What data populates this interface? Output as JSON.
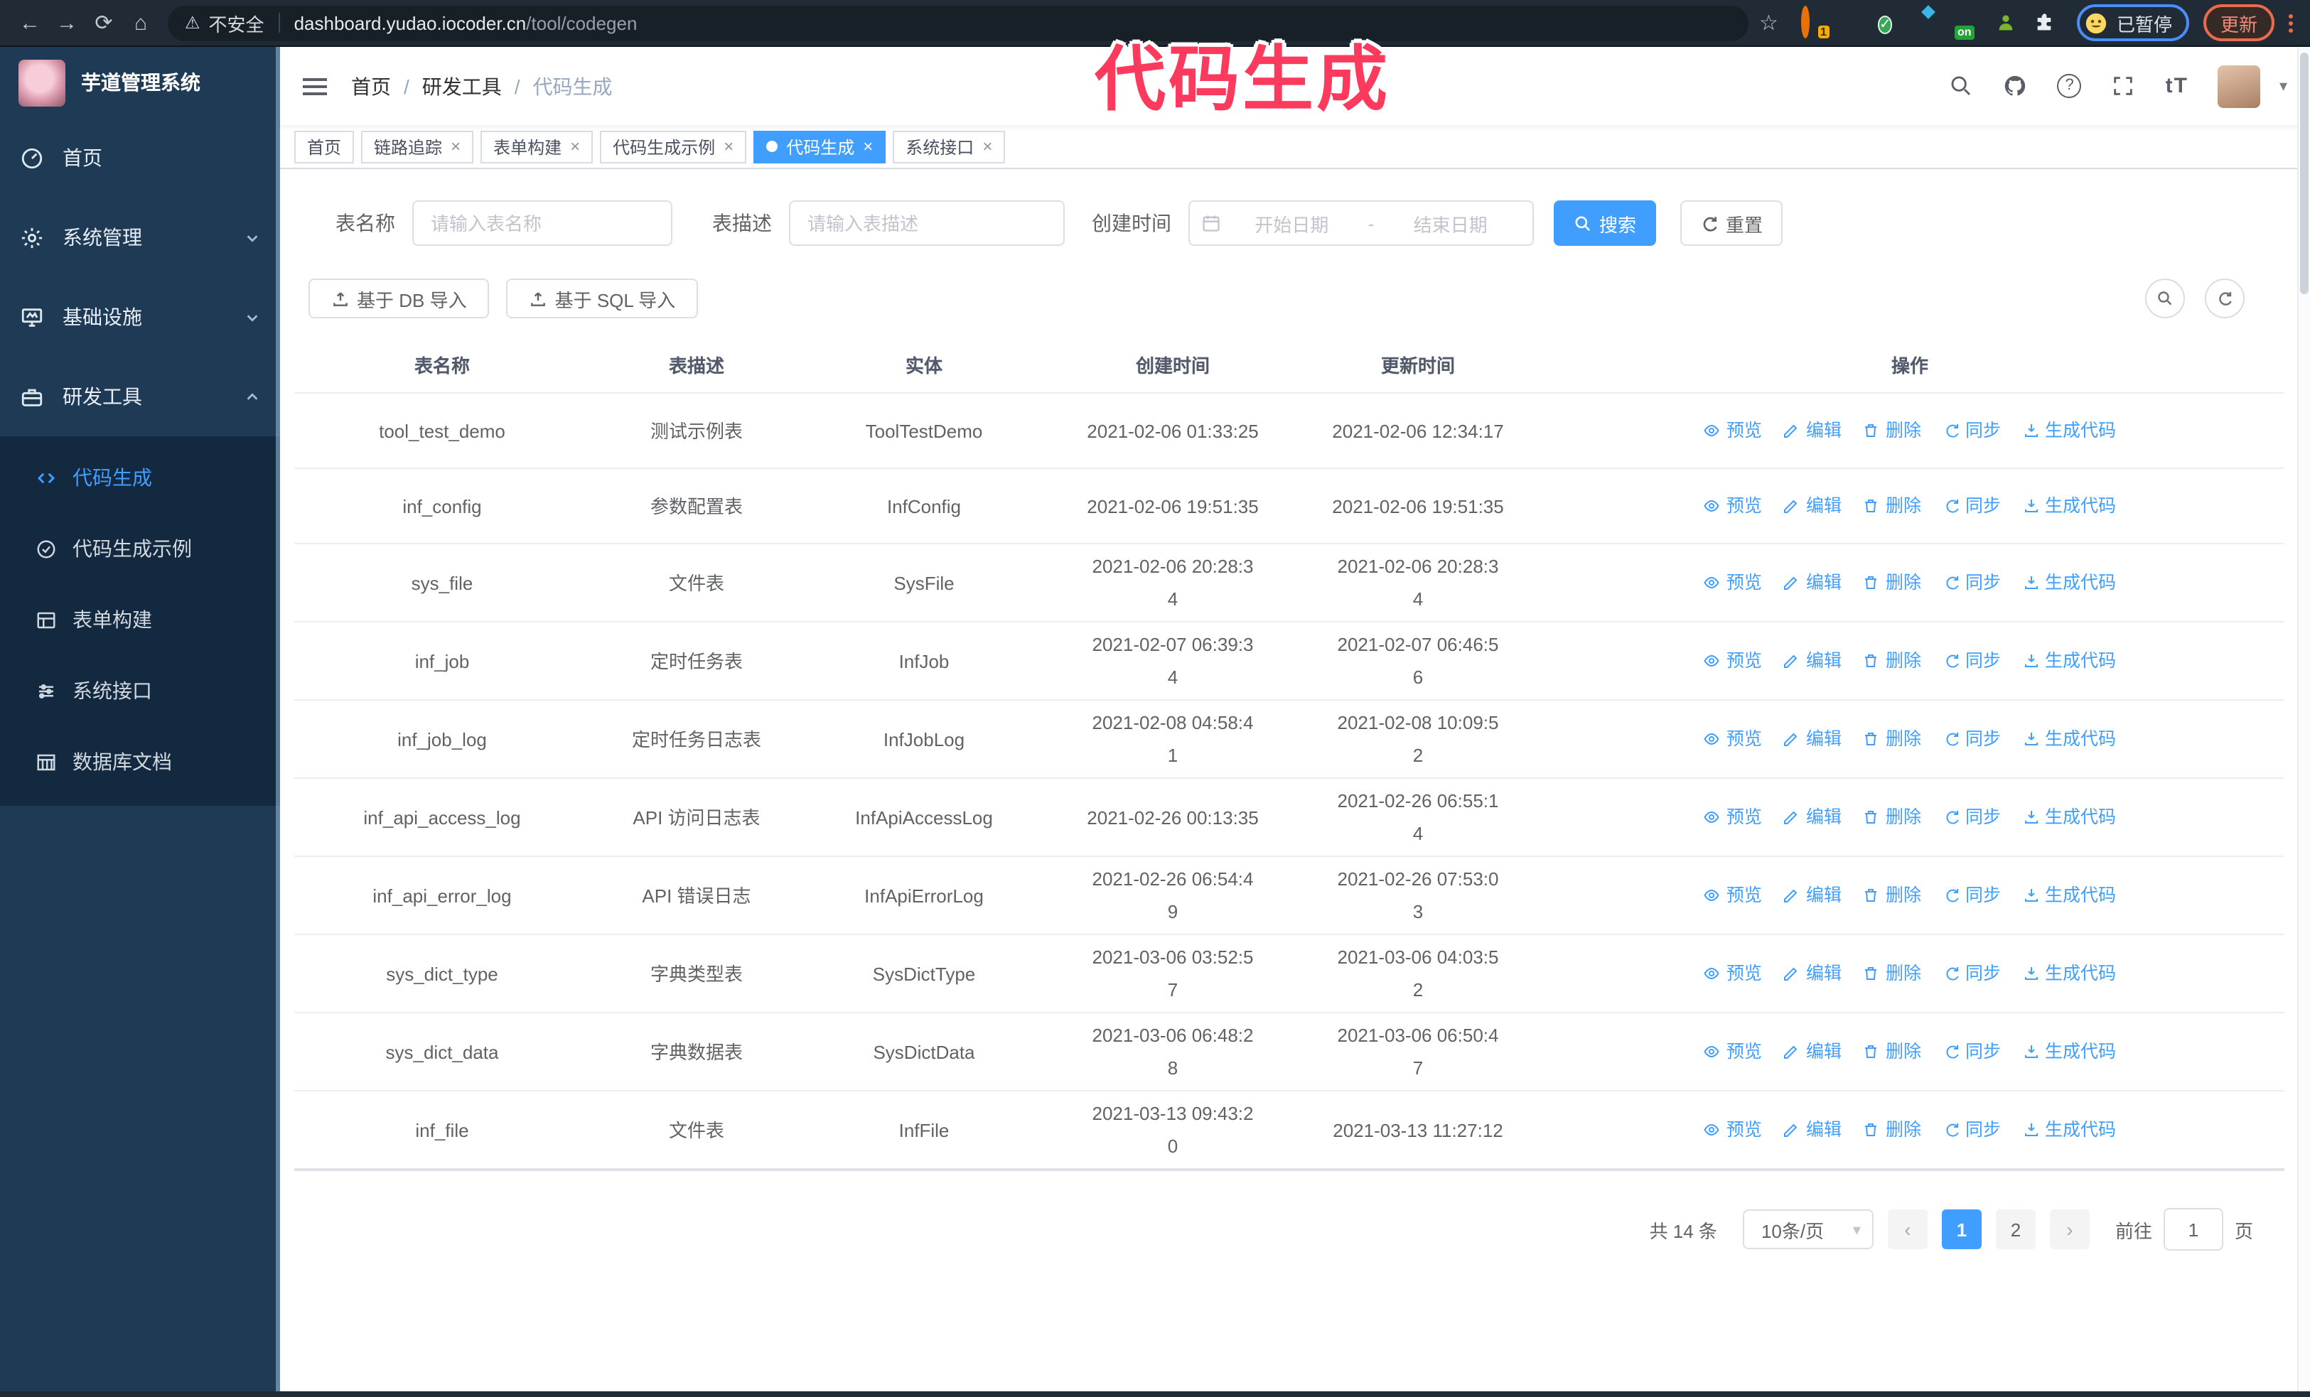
{
  "theme": {
    "accent": "#409eff",
    "annotation_color": "#fb3a5d",
    "sidebar_bg": "#1e3a54",
    "submenu_bg": "#12293f",
    "browser_bar_bg": "#202b36"
  },
  "annotation": {
    "text": "代码生成"
  },
  "browser": {
    "back_glyph": "←",
    "forward_glyph": "→",
    "reload_glyph": "⟳",
    "home_glyph": "⌂",
    "warning_glyph": "⚠",
    "security_label": "不安全",
    "url_domain": "dashboard.yudao.iocoder.cn",
    "url_path": "/tool/codegen",
    "bookmark_glyph": "☆",
    "ext_badge_count": "1",
    "ext_on_label": "on",
    "paused_badge": "已暂停",
    "update_button": "更新"
  },
  "sidebar": {
    "logo_title": "芋道管理系统",
    "items": [
      {
        "label": "首页"
      },
      {
        "label": "系统管理"
      },
      {
        "label": "基础设施"
      },
      {
        "label": "研发工具"
      }
    ],
    "submenu": [
      {
        "label": "代码生成"
      },
      {
        "label": "代码生成示例"
      },
      {
        "label": "表单构建"
      },
      {
        "label": "系统接口"
      },
      {
        "label": "数据库文档"
      }
    ]
  },
  "header": {
    "breadcrumb": [
      "首页",
      "研发工具",
      "代码生成"
    ],
    "separator": "/",
    "help_glyph": "?",
    "font_size_glyph": "tT",
    "caret_glyph": "▾"
  },
  "tabs": [
    {
      "label": "首页",
      "closable": false,
      "active": false
    },
    {
      "label": "链路追踪",
      "closable": true,
      "active": false
    },
    {
      "label": "表单构建",
      "closable": true,
      "active": false
    },
    {
      "label": "代码生成示例",
      "closable": true,
      "active": false
    },
    {
      "label": "代码生成",
      "closable": true,
      "active": true
    },
    {
      "label": "系统接口",
      "closable": true,
      "active": false
    }
  ],
  "close_glyph": "×",
  "filters": {
    "table_name_label": "表名称",
    "table_name_placeholder": "请输入表名称",
    "table_desc_label": "表描述",
    "table_desc_placeholder": "请输入表描述",
    "create_time_label": "创建时间",
    "date_start_placeholder": "开始日期",
    "date_separator": "-",
    "date_end_placeholder": "结束日期",
    "search_label": "搜索",
    "reset_label": "重置"
  },
  "toolbar": {
    "import_db_label": "基于 DB 导入",
    "import_sql_label": "基于 SQL 导入"
  },
  "table": {
    "columns": [
      "表名称",
      "表描述",
      "实体",
      "创建时间",
      "更新时间",
      "操作"
    ],
    "actions": [
      "预览",
      "编辑",
      "删除",
      "同步",
      "生成代码"
    ],
    "rows": [
      {
        "name": "tool_test_demo",
        "desc": "测试示例表",
        "entity": "ToolTestDemo",
        "create_time": "2021-02-06 01:33:25",
        "update_time": "2021-02-06 12:34:17"
      },
      {
        "name": "inf_config",
        "desc": "参数配置表",
        "entity": "InfConfig",
        "create_time": "2021-02-06 19:51:35",
        "update_time": "2021-02-06 19:51:35"
      },
      {
        "name": "sys_file",
        "desc": "文件表",
        "entity": "SysFile",
        "create_time": "2021-02-06 20:28:3\n4",
        "update_time": "2021-02-06 20:28:3\n4"
      },
      {
        "name": "inf_job",
        "desc": "定时任务表",
        "entity": "InfJob",
        "create_time": "2021-02-07 06:39:3\n4",
        "update_time": "2021-02-07 06:46:5\n6"
      },
      {
        "name": "inf_job_log",
        "desc": "定时任务日志表",
        "entity": "InfJobLog",
        "create_time": "2021-02-08 04:58:4\n1",
        "update_time": "2021-02-08 10:09:5\n2"
      },
      {
        "name": "inf_api_access_log",
        "desc": "API 访问日志表",
        "entity": "InfApiAccessLog",
        "create_time": "2021-02-26 00:13:35",
        "update_time": "2021-02-26 06:55:1\n4"
      },
      {
        "name": "inf_api_error_log",
        "desc": "API 错误日志",
        "entity": "InfApiErrorLog",
        "create_time": "2021-02-26 06:54:4\n9",
        "update_time": "2021-02-26 07:53:0\n3"
      },
      {
        "name": "sys_dict_type",
        "desc": "字典类型表",
        "entity": "SysDictType",
        "create_time": "2021-03-06 03:52:5\n7",
        "update_time": "2021-03-06 04:03:5\n2"
      },
      {
        "name": "sys_dict_data",
        "desc": "字典数据表",
        "entity": "SysDictData",
        "create_time": "2021-03-06 06:48:2\n8",
        "update_time": "2021-03-06 06:50:4\n7"
      },
      {
        "name": "inf_file",
        "desc": "文件表",
        "entity": "InfFile",
        "create_time": "2021-03-13 09:43:2\n0",
        "update_time": "2021-03-13 11:27:12"
      }
    ]
  },
  "pagination": {
    "total": "共 14 条",
    "page_size": "10条/页",
    "pages": [
      "1",
      "2"
    ],
    "prev_glyph": "‹",
    "next_glyph": "›",
    "goto_label": "前往",
    "goto_value": "1",
    "goto_suffix": "页"
  }
}
